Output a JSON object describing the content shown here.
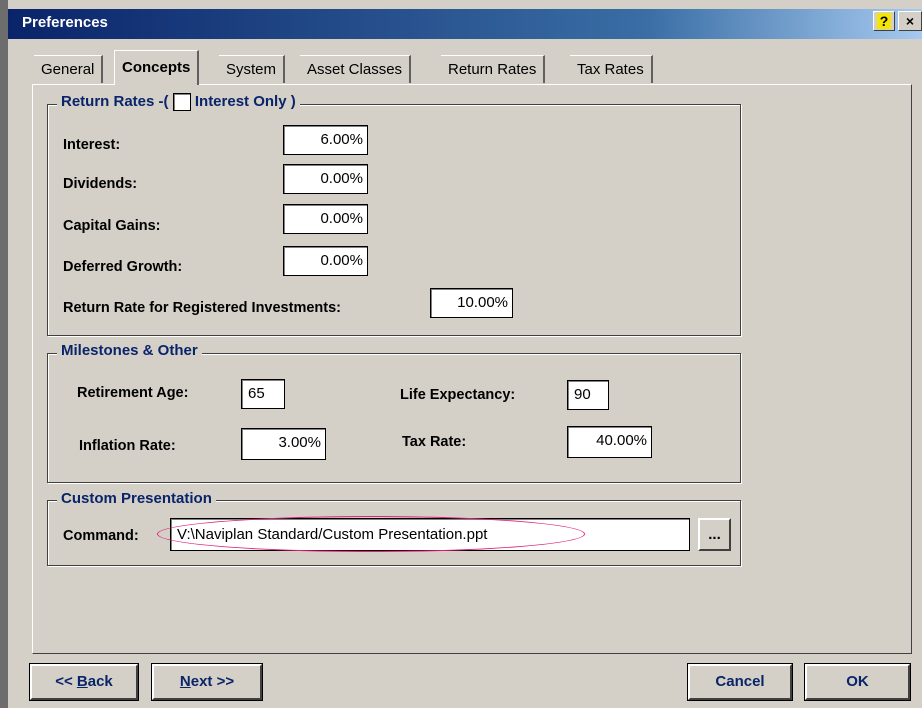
{
  "window": {
    "title": "Preferences",
    "help_glyph": "?",
    "close_glyph": "×"
  },
  "tabs": [
    {
      "label": "General",
      "active": false
    },
    {
      "label": "Concepts",
      "active": true
    },
    {
      "label": "System",
      "active": false
    },
    {
      "label": "Asset Classes",
      "active": false
    },
    {
      "label": "Return Rates",
      "active": false
    },
    {
      "label": "Tax Rates",
      "active": false
    }
  ],
  "return_rates": {
    "legend_prefix": "Return Rates -(",
    "checkbox_label": "Interest Only",
    "legend_suffix": ")",
    "interest_only_checked": false,
    "interest_label": "Interest:",
    "interest_value": "6.00%",
    "dividends_label": "Dividends:",
    "dividends_value": "0.00%",
    "capital_gains_label": "Capital Gains:",
    "capital_gains_value": "0.00%",
    "deferred_growth_label": "Deferred Growth:",
    "deferred_growth_value": "0.00%",
    "registered_label": "Return Rate for Registered Investments:",
    "registered_value": "10.00%"
  },
  "milestones": {
    "legend": "Milestones & Other",
    "retirement_age_label": "Retirement Age:",
    "retirement_age_value": "65",
    "life_expectancy_label": "Life Expectancy:",
    "life_expectancy_value": "90",
    "inflation_rate_label": "Inflation Rate:",
    "inflation_rate_value": "3.00%",
    "tax_rate_label": "Tax Rate:",
    "tax_rate_value": "40.00%"
  },
  "custom_presentation": {
    "legend": "Custom Presentation",
    "command_label": "Command:",
    "command_value": "V:\\Naviplan Standard/Custom Presentation.ppt",
    "browse_label": "...",
    "highlight_color": "#e0207a"
  },
  "buttons": {
    "back_prefix": "<< ",
    "back_accel": "B",
    "back_rest": "ack",
    "next_accel": "N",
    "next_rest": "ext >>",
    "cancel": "Cancel",
    "ok": "OK"
  }
}
